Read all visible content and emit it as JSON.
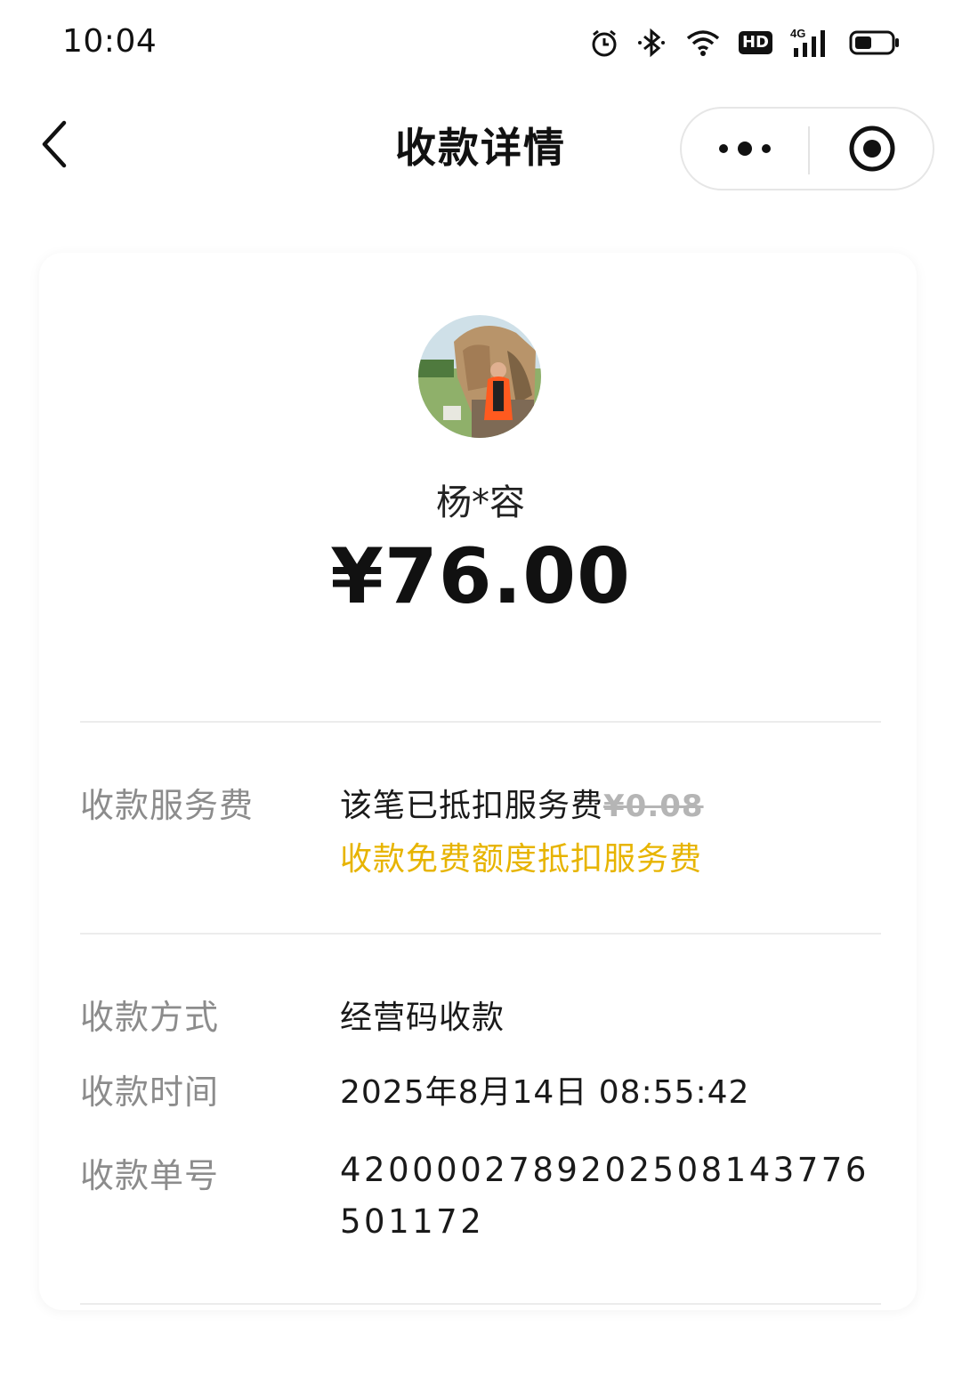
{
  "status_bar": {
    "time": "10:04",
    "network": "4G",
    "hd_label": "HD",
    "icons": [
      "alarm-icon",
      "bluetooth-icon",
      "wifi-icon",
      "hd-icon",
      "signal-icon",
      "battery-icon"
    ]
  },
  "nav": {
    "title": "收款详情",
    "back_icon": "chevron-left-icon",
    "more_icon": "more-dots-icon",
    "close_icon": "record-circle-icon"
  },
  "payment": {
    "payer_name": "杨*容",
    "amount": "¥76.00"
  },
  "details": {
    "fee": {
      "label": "收款服务费",
      "value": "该笔已抵扣服务费",
      "original_fee": "¥0.08",
      "note": "收款免费额度抵扣服务费"
    },
    "method": {
      "label": "收款方式",
      "value": "经营码收款"
    },
    "time": {
      "label": "收款时间",
      "value": "2025年8月14日 08:55:42"
    },
    "order": {
      "label": "收款单号",
      "value": "42000027892025081437765011 72"
    }
  },
  "colors": {
    "accent_yellow": "#e7b400",
    "label_gray": "#8c8c8c",
    "text_dark": "#1a1a1a",
    "strike_gray": "#b5b5b5"
  }
}
